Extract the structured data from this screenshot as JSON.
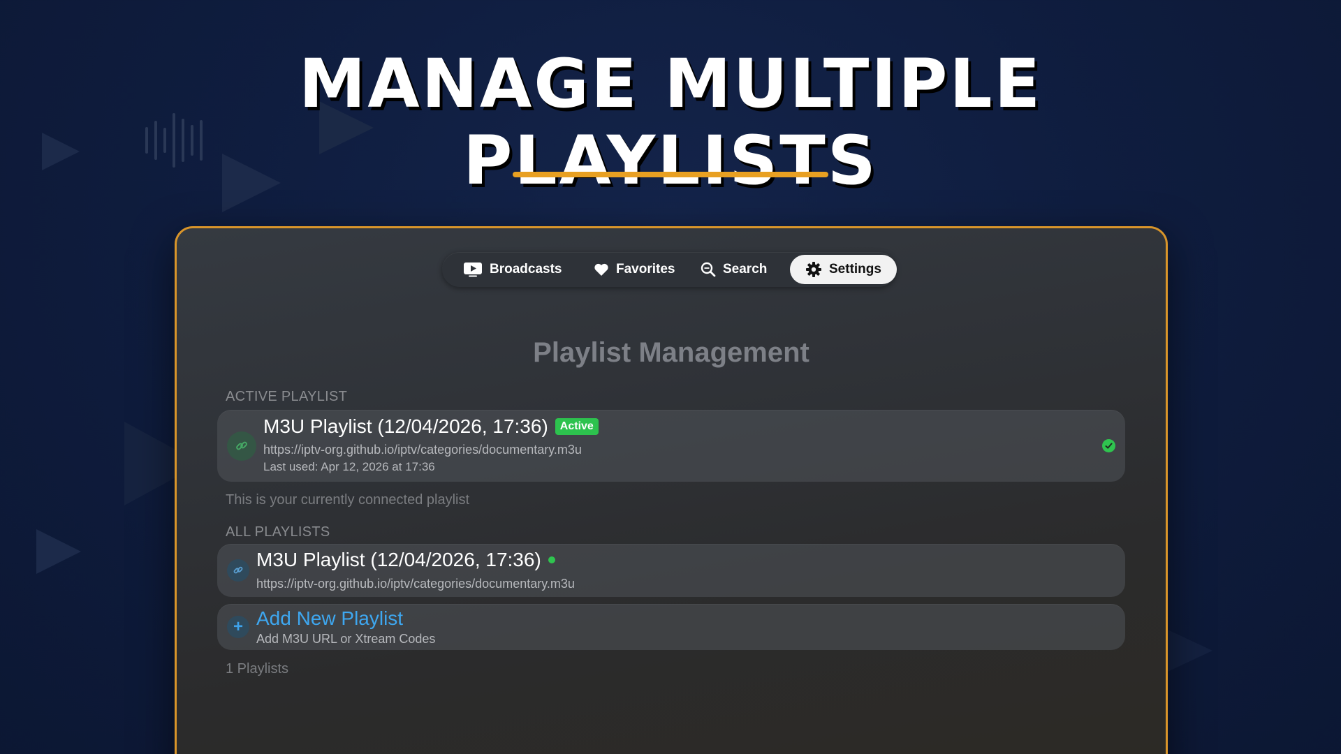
{
  "headline": {
    "line1": "MANAGE MULTIPLE",
    "line2": "PLAYLISTS"
  },
  "colors": {
    "accent": "#e8a022",
    "active_green": "#2dc24e",
    "link_blue": "#3ea7f0"
  },
  "tabs": [
    {
      "label": "Broadcasts",
      "icon": "play-screen-icon",
      "selected": false
    },
    {
      "label": "Favorites",
      "icon": "heart-icon",
      "selected": false
    },
    {
      "label": "Search",
      "icon": "search-icon",
      "selected": false
    },
    {
      "label": "Settings",
      "icon": "gear-icon",
      "selected": true
    }
  ],
  "main": {
    "title": "Playlist Management",
    "active_section": {
      "label": "ACTIVE PLAYLIST",
      "playlist": {
        "name": "M3U Playlist (12/04/2026, 17:36)",
        "badge": "Active",
        "url": "https://iptv-org.github.io/iptv/categories/documentary.m3u",
        "last_used": "Last used: Apr 12, 2026 at 17:36",
        "icon": "link-icon",
        "status_icon": "checkmark-circle-icon"
      },
      "description": "This is your currently connected playlist"
    },
    "all_section": {
      "label": "ALL PLAYLISTS",
      "playlists": [
        {
          "name": "M3U Playlist (12/04/2026, 17:36)",
          "url": "https://iptv-org.github.io/iptv/categories/documentary.m3u",
          "icon": "link-icon",
          "status": "connected"
        }
      ],
      "add_new": {
        "title": "Add New Playlist",
        "subtitle": "Add M3U URL or Xtream Codes",
        "icon": "plus-icon"
      },
      "count": "1 Playlists"
    }
  }
}
